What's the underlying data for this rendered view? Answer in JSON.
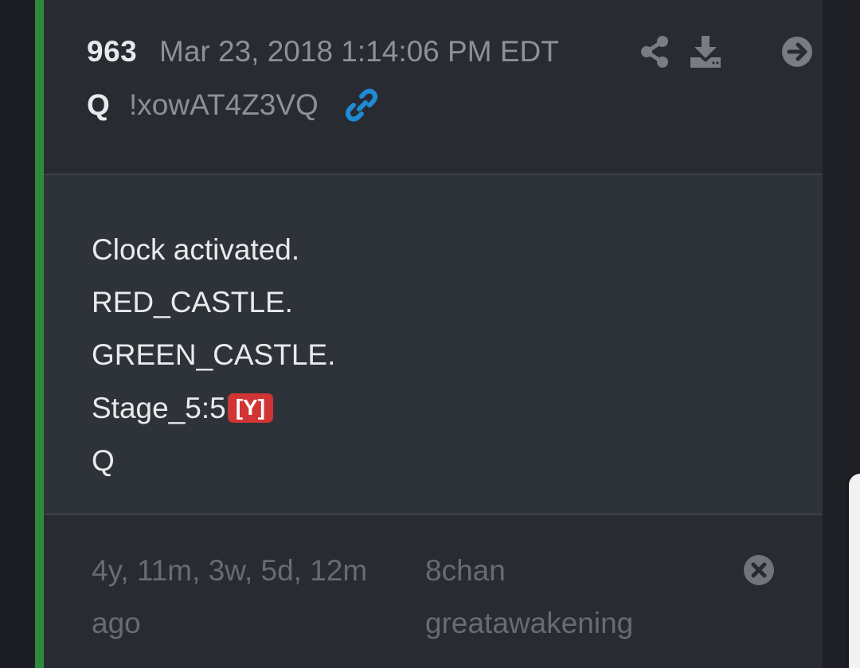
{
  "post": {
    "number": "963",
    "date": "Mar 23, 2018 1:14:06 PM EDT",
    "author": "Q",
    "tripcode": "!xowAT4Z3VQ",
    "lines": {
      "line1": "Clock activated.",
      "line2": "RED_CASTLE.",
      "line3": "GREEN_CASTLE.",
      "line4": "Stage_5:5",
      "line5": "Q"
    },
    "reply_badge": "[Y]"
  },
  "footer": {
    "age_line1": "4y, 11m, 3w, 5d, 12m",
    "age_line2": "ago",
    "source_line1": "8chan",
    "source_line2": "greatawakening"
  },
  "icons": {
    "share": "share-icon",
    "download": "download-icon",
    "goto": "arrow-circle-right-icon",
    "link": "link-icon",
    "close": "close-circle-icon"
  },
  "colors": {
    "accent_bar": "#2f8a3d",
    "badge": "#d03434",
    "link": "#1f8ad6",
    "text_primary": "#e9eaec",
    "text_muted": "#8d9099"
  }
}
